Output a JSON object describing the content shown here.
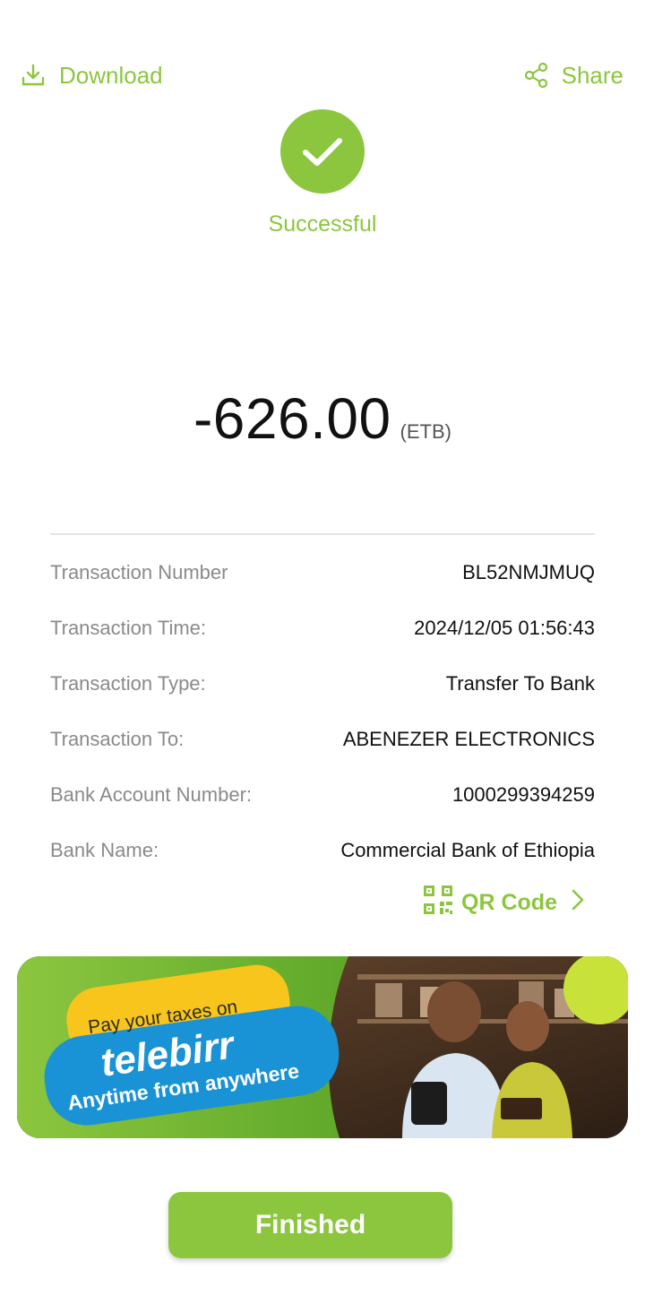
{
  "header": {
    "download_label": "Download",
    "share_label": "Share",
    "download_icon": "download-icon",
    "share_icon": "share-icon"
  },
  "status": {
    "icon": "check-icon",
    "text": "Successful"
  },
  "amount": {
    "value": "-626.00",
    "currency": "(ETB)"
  },
  "details": [
    {
      "label": "Transaction Number",
      "value": "BL52NMJMUQ"
    },
    {
      "label": "Transaction Time:",
      "value": "2024/12/05 01:56:43"
    },
    {
      "label": "Transaction Type:",
      "value": "Transfer To Bank"
    },
    {
      "label": "Transaction To:",
      "value": "ABENEZER ELECTRONICS"
    },
    {
      "label": "Bank Account Number:",
      "value": "1000299394259"
    },
    {
      "label": "Bank Name:",
      "value": "Commercial Bank of Ethiopia"
    }
  ],
  "qr_link": {
    "label": "QR Code",
    "icon": "qr-code-icon"
  },
  "banner": {
    "line1": "Pay your taxes on",
    "brand": "telebirr",
    "line3": "Anytime from anywhere"
  },
  "footer": {
    "finish_label": "Finished"
  },
  "colors": {
    "accent": "#8cc63f",
    "text": "#111111",
    "muted": "#8a8a8a"
  }
}
